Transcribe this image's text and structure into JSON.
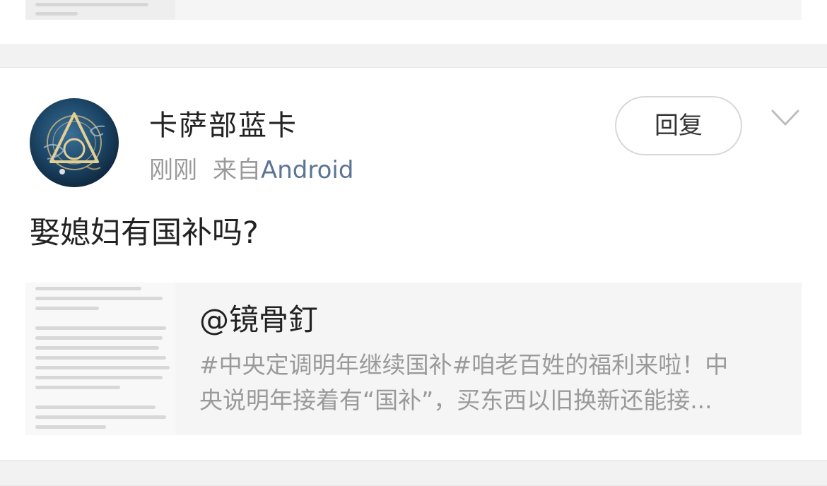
{
  "post": {
    "username": "卡萨部蓝卡",
    "time": "刚刚",
    "from_label": "来自",
    "device": "Android",
    "reply_label": "回复",
    "text": "娶媳妇有国补吗?",
    "quote": {
      "author": "@镜骨釘",
      "snippet_line1": "#中央定调明年继续国补#咱老百姓的福利来啦！中",
      "snippet_line2": "央说明年接着有“国补”，买东西以旧换新还能接..."
    }
  },
  "colors": {
    "link": "#5b7494",
    "secondary_text": "#9a9a9a",
    "divider": "#f2f2f2"
  },
  "icons": {
    "menu": "chevron-down-icon"
  }
}
